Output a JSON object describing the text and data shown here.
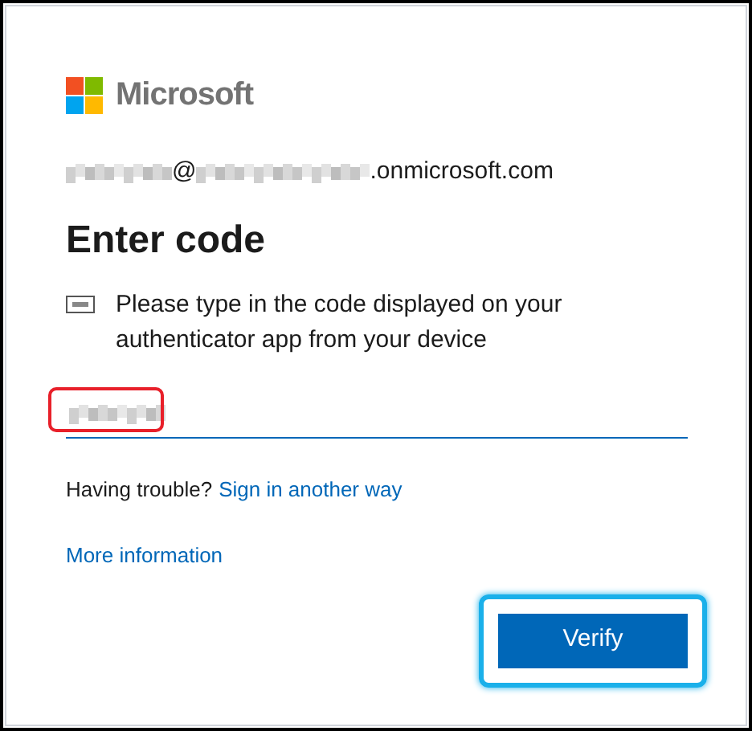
{
  "brand": {
    "name": "Microsoft"
  },
  "account": {
    "separator": "@",
    "domain_suffix": ".onmicrosoft.com"
  },
  "title": "Enter code",
  "instruction": "Please type in the code displayed on your authenticator app from your device",
  "code_field": {
    "value_redacted": true,
    "highlighted": true
  },
  "trouble": {
    "text": "Having trouble?",
    "link": "Sign in another way"
  },
  "more_info": "More information",
  "verify_button": {
    "label": "Verify",
    "highlighted": true
  }
}
